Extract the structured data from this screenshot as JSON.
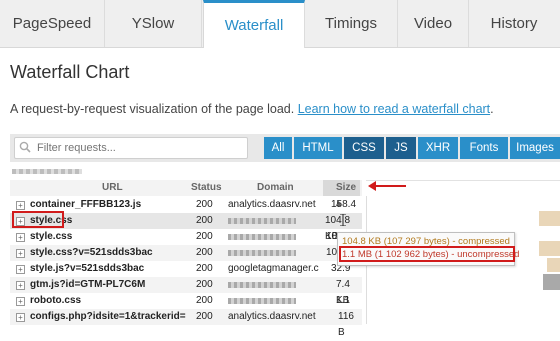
{
  "tabs": [
    {
      "label": "PageSpeed",
      "active": false
    },
    {
      "label": "YSlow",
      "active": false
    },
    {
      "label": "Waterfall",
      "active": true
    },
    {
      "label": "Timings",
      "active": false
    },
    {
      "label": "Video",
      "active": false
    },
    {
      "label": "History",
      "active": false
    }
  ],
  "page": {
    "title": "Waterfall Chart",
    "intro_text": "A request-by-request visualization of the page load. ",
    "intro_link": "Learn how to read a waterfall chart",
    "intro_end": "."
  },
  "filter": {
    "placeholder": "Filter requests...",
    "buttons": [
      "All",
      "HTML",
      "CSS",
      "JS",
      "XHR",
      "Fonts",
      "Images"
    ],
    "selected": [
      "CSS",
      "JS"
    ]
  },
  "table": {
    "headers": {
      "url": "URL",
      "status": "Status",
      "domain": "Domain",
      "size": "Size ▴"
    },
    "rows": [
      {
        "url": "container_FFFBB123.js",
        "status": "200",
        "domain": "analytics.daasrv.net",
        "size": "158.4 KB",
        "domain_hidden": false
      },
      {
        "url": "style.css",
        "status": "200",
        "domain": "",
        "size": "104.8 KB",
        "domain_hidden": true
      },
      {
        "url": "style.css",
        "status": "200",
        "domain": "",
        "size": "10",
        "domain_hidden": true
      },
      {
        "url": "style.css?v=521sdds3bac",
        "status": "200",
        "domain": "",
        "size": "10",
        "domain_hidden": true
      },
      {
        "url": "style.js?v=521sdds3bac",
        "status": "200",
        "domain": "googletagmanager.c",
        "size": "32.9 KB",
        "domain_hidden": false
      },
      {
        "url": "gtm.js?id=GTM-PL7C6M",
        "status": "200",
        "domain": "",
        "size": "7.4 KB",
        "domain_hidden": true
      },
      {
        "url": "roboto.css",
        "status": "200",
        "domain": "",
        "size": "1.1 KB",
        "domain_hidden": true
      },
      {
        "url": "configs.php?idsite=1&trackerid=",
        "status": "200",
        "domain": "analytics.daasrv.net",
        "size": "116 B",
        "domain_hidden": false
      }
    ]
  },
  "tooltip": {
    "compressed": "104.8 KB (107 297 bytes) - compressed",
    "uncompressed": "1.1 MB (1 102 962 bytes) - uncompressed"
  },
  "colors": {
    "accent": "#2a8fc9",
    "button_selected": "#1d5f8e",
    "highlight": "#d11b1b"
  }
}
